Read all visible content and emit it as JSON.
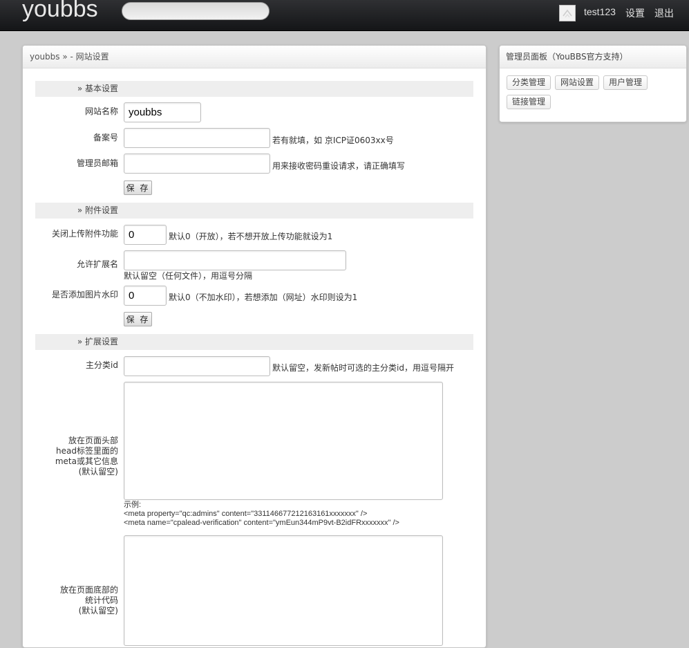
{
  "header": {
    "logo": "youbbs",
    "search_value": "",
    "user_name": "test123",
    "settings_label": "设置",
    "logout_label": "退出"
  },
  "breadcrumb": {
    "home": "youbbs",
    "separator": " » - ",
    "current": "网站设置"
  },
  "form": {
    "basic": {
      "section_title": "» 基本设置",
      "site_name_label": "网站名称",
      "site_name_value": "youbbs",
      "icp_label": "备案号",
      "icp_value": "",
      "icp_hint": "若有就填，如 京ICP证0603xx号",
      "admin_email_label": "管理员邮箱",
      "admin_email_value": "",
      "admin_email_hint": "用来接收密码重设请求，请正确填写",
      "save_label": "保 存"
    },
    "attachment": {
      "section_title": "» 附件设置",
      "close_upload_label": "关闭上传附件功能",
      "close_upload_value": "0",
      "close_upload_hint": "默认0（开放），若不想开放上传功能就设为1",
      "ext_label": "允许扩展名",
      "ext_value": "",
      "ext_hint": "默认留空（任何文件），用逗号分隔",
      "watermark_label": "是否添加图片水印",
      "watermark_value": "0",
      "watermark_hint": "默认0（不加水印），若想添加（网址）水印则设为1",
      "save_label": "保 存"
    },
    "extend": {
      "section_title": "» 扩展设置",
      "main_cat_label": "主分类id",
      "main_cat_value": "",
      "main_cat_hint": "默认留空，发新帖时可选的主分类id，用逗号隔开",
      "head_meta_label_1": "放在页面头部",
      "head_meta_label_2": "head标签里面的",
      "head_meta_label_3": "meta或其它信息",
      "head_meta_label_4": "(默认留空)",
      "head_meta_value": "",
      "example_title": "示例:",
      "example_line_1": "<meta property=\"qc:admins\" content=\"331146677212163161xxxxxxx\" />",
      "example_line_2": "<meta name=\"cpalead-verification\" content=\"ymEun344mP9vt-B2idFRxxxxxxx\" />",
      "footer_label_1": "放在页面底部的",
      "footer_label_2": "统计代码",
      "footer_label_3": "(默认留空)",
      "footer_value": ""
    }
  },
  "sidebar": {
    "title": "管理员面板（YouBBS官方支持）",
    "buttons": [
      "分类管理",
      "网站设置",
      "用户管理",
      "链接管理"
    ]
  }
}
